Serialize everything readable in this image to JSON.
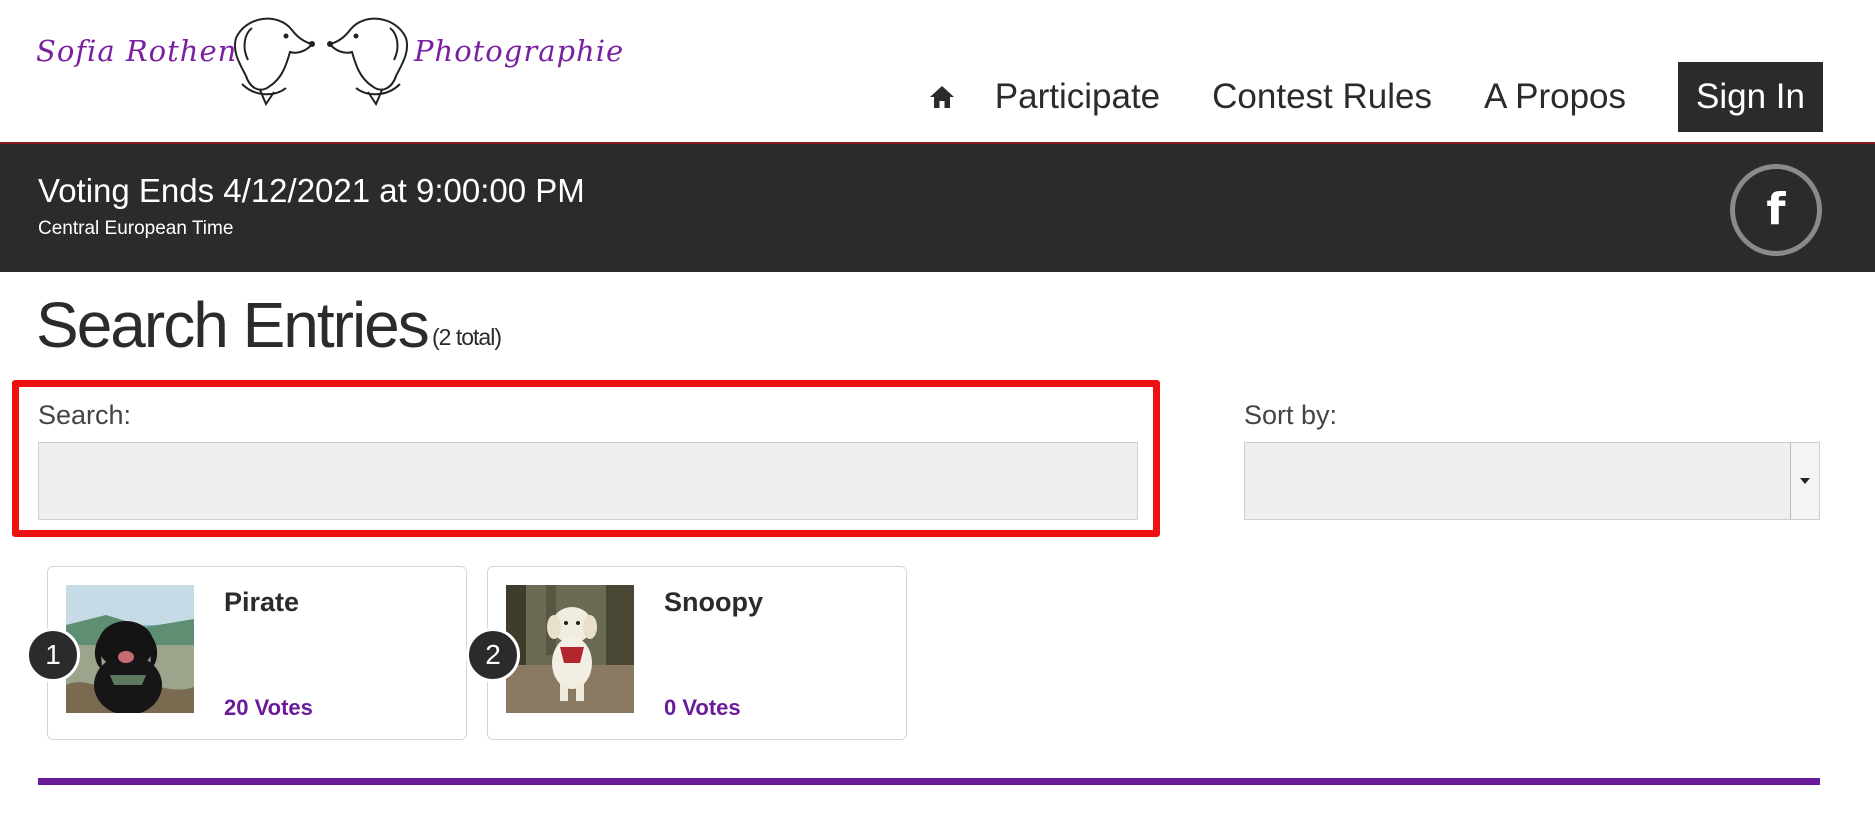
{
  "header": {
    "logo": {
      "left_text": "Sofia Rothen",
      "right_text": "Photographie"
    },
    "nav": {
      "home_icon": "home-icon",
      "items": [
        "Participate",
        "Contest Rules",
        "A Propos"
      ],
      "signin": "Sign In"
    }
  },
  "banner": {
    "title": "Voting Ends 4/12/2021 at 9:00:00 PM",
    "subtitle": "Central European Time",
    "social_icon": "facebook-icon"
  },
  "page": {
    "title": "Search Entries",
    "total": "(2 total)"
  },
  "search": {
    "label": "Search:",
    "value": "",
    "placeholder": ""
  },
  "sort": {
    "label": "Sort by:",
    "selected": ""
  },
  "entries": [
    {
      "rank": "1",
      "name": "Pirate",
      "votes": "20 Votes",
      "photo": "black-dog-photo"
    },
    {
      "rank": "2",
      "name": "Snoopy",
      "votes": "0 Votes",
      "photo": "golden-retriever-photo"
    }
  ],
  "colors": {
    "accent": "#6a1b9a",
    "banner_bg": "#2b2b2b",
    "highlight_border": "#ee1111",
    "header_line": "#8b1a1a"
  }
}
